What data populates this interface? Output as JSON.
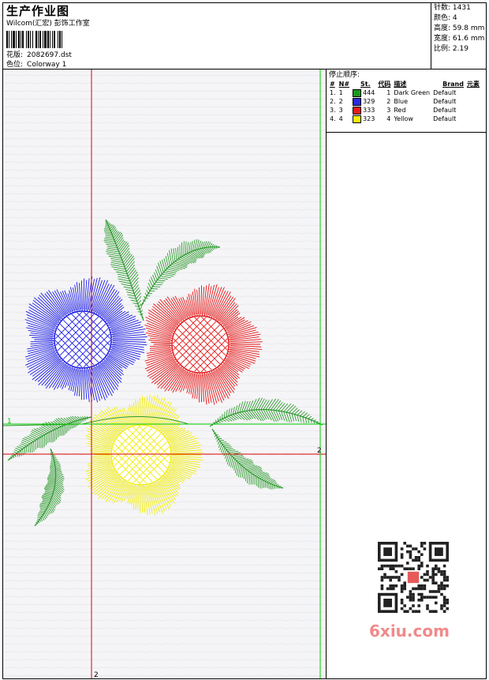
{
  "header": {
    "title": "生产作业图",
    "studio": "Wilcom(汇宏) 彭饰工作室",
    "design_label": "花版:",
    "design_file": "2082697.dst",
    "colorway_label": "色位:",
    "colorway": "Colorway 1"
  },
  "stats": [
    {
      "label": "针数",
      "value": "1431"
    },
    {
      "label": "颜色",
      "value": "4"
    },
    {
      "label": "高度",
      "value": "59.8 mm"
    },
    {
      "label": "宽度",
      "value": "61.6 mm"
    },
    {
      "label": "比例",
      "value": "2.19"
    }
  ],
  "stop_sequence": {
    "title": "停止顺序:",
    "columns": [
      "#",
      "N#",
      "St.",
      "代码",
      "描述",
      "Brand",
      "元素"
    ],
    "rows": [
      {
        "idx": "1.",
        "n": "1",
        "color": "#1a9a1a",
        "st": "444",
        "code": "1",
        "desc": "Dark Green",
        "brand": "Default"
      },
      {
        "idx": "2.",
        "n": "2",
        "color": "#2a2ae0",
        "st": "329",
        "code": "2",
        "desc": "Blue",
        "brand": "Default"
      },
      {
        "idx": "3.",
        "n": "3",
        "color": "#e81818",
        "st": "333",
        "code": "3",
        "desc": "Red",
        "brand": "Default"
      },
      {
        "idx": "4.",
        "n": "4",
        "color": "#f4f000",
        "st": "323",
        "code": "4",
        "desc": "Yellow",
        "brand": "Default"
      }
    ]
  },
  "guides": {
    "red_h_label": "2",
    "red_v_label": "2",
    "green_label": "1"
  },
  "colors": {
    "green": "#2e9a2e",
    "blue": "#1a1ae6",
    "red": "#e81414",
    "yellow": "#f2ee00",
    "guide_red": "#e00000",
    "guide_green": "#00cc00"
  },
  "watermark": "6xiu.com"
}
